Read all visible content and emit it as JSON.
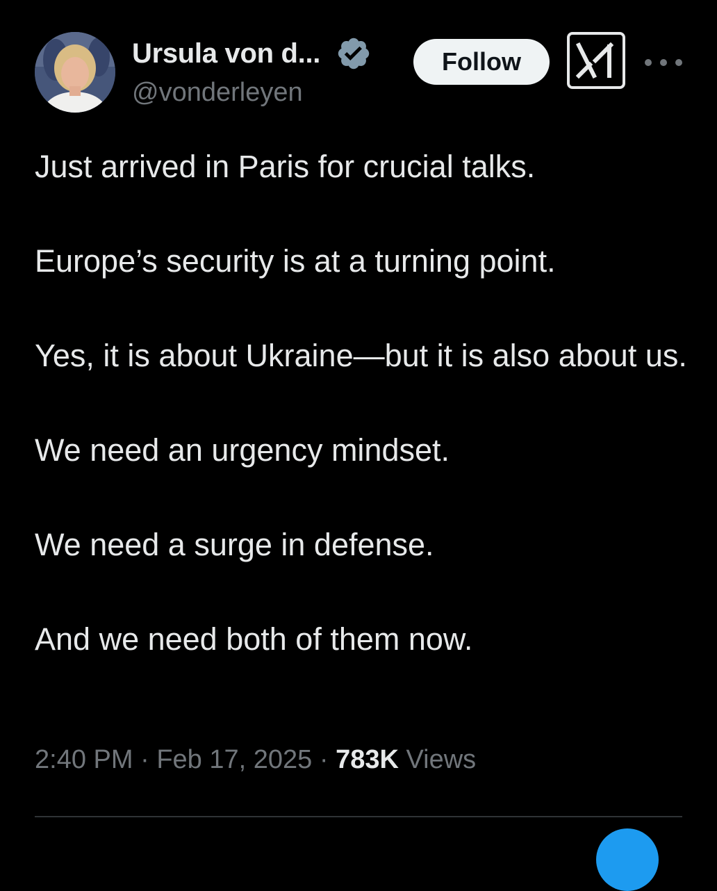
{
  "author": {
    "display_name": "Ursula von d...",
    "handle": "@vonderleyen",
    "verified_icon": "verified-badge-icon",
    "verified_color": "#829aab",
    "avatar_icon": "profile-photo"
  },
  "actions": {
    "follow_label": "Follow",
    "grok_icon": "grok-icon",
    "more_icon": "more-options-icon"
  },
  "tweet": {
    "paragraphs": [
      "Just arrived in Paris for crucial talks.",
      "Europe’s security is at a turning point.",
      "Yes, it is about Ukraine—but it is also about us.",
      "We need an urgency mindset.",
      "We need a surge in defense.",
      "And we need both of them now."
    ]
  },
  "meta": {
    "time": "2:40 PM",
    "separator": "·",
    "date": "Feb 17, 2025",
    "views_count": "783K",
    "views_label": "Views"
  },
  "colors": {
    "background": "#000000",
    "text": "#e7e9ea",
    "secondary_text": "#71767b",
    "accent": "#1d9bf0"
  }
}
